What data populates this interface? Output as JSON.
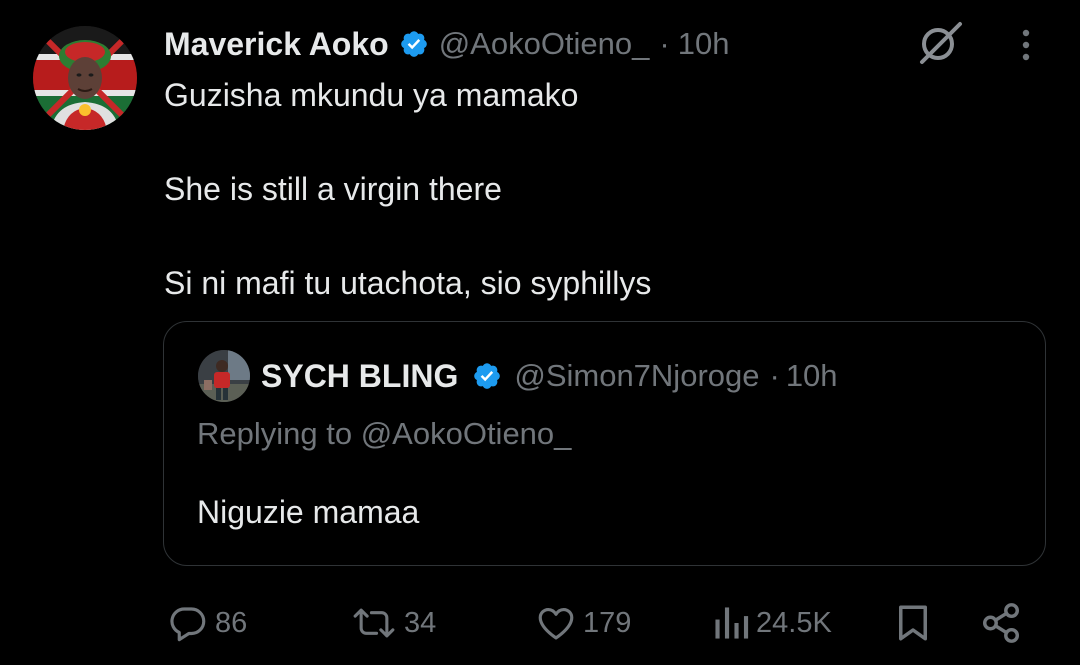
{
  "post": {
    "author": {
      "display_name": "Maverick Aoko",
      "handle": "@AokoOtieno_",
      "verified": true
    },
    "separator": "·",
    "time": "10h",
    "text_lines": [
      "Guzisha mkundu ya mamako",
      "She is still a virgin there",
      "Si ni mafi tu utachota, sio syphillys"
    ]
  },
  "quote": {
    "author": {
      "display_name": "SYCH BLING",
      "handle": "@Simon7Njoroge",
      "verified": true
    },
    "separator": "·",
    "time": "10h",
    "replying_to": "Replying to @AokoOtieno_",
    "text": "Niguzie mamaa"
  },
  "actions": {
    "replies": "86",
    "reposts": "34",
    "likes": "179",
    "views": "24.5K"
  },
  "icons": {
    "reply": "reply-bubble-icon",
    "repost": "repost-icon",
    "like": "heart-icon",
    "views": "views-bar-chart-icon",
    "bookmark": "bookmark-icon",
    "share": "share-icon",
    "grok": "grok-icon",
    "more": "more-vertical-icon",
    "verified": "verified-badge-icon"
  },
  "colors": {
    "background": "#000000",
    "text_primary": "#e7e9ea",
    "text_secondary": "#71767b",
    "verified_blue": "#1d9bf0",
    "border": "#2f3336"
  }
}
